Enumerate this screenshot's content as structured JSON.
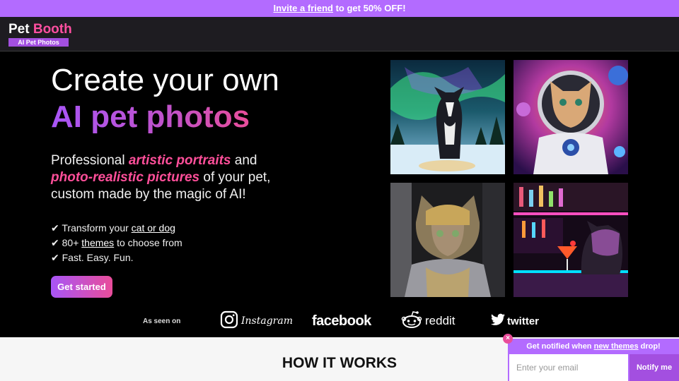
{
  "promo": {
    "link_text": "Invite a friend",
    "rest_text": " to get 50% OFF!"
  },
  "logo": {
    "word1": "Pet",
    "word2": "Booth",
    "subtitle": "AI Pet Photos"
  },
  "hero": {
    "title_line1": "Create your own",
    "title_line2": "AI pet photos",
    "desc_part1": "Professional ",
    "desc_highlight1": "artistic portraits",
    "desc_part2": " and ",
    "desc_highlight2": "photo-realistic pictures",
    "desc_part3": " of your pet, custom made by the magic of AI!",
    "features": [
      {
        "check": "✔",
        "before": " Transform your ",
        "link": "cat or dog",
        "after": ""
      },
      {
        "check": "✔",
        "before": " 80+ ",
        "link": "themes",
        "after": " to choose from"
      },
      {
        "check": "✔",
        "before": " Fast. Easy. Fun.",
        "link": "",
        "after": ""
      }
    ],
    "cta_label": "Get started"
  },
  "gallery": {
    "photos": [
      {
        "subject": "dog under northern lights",
        "icon": "dog-aurora-photo"
      },
      {
        "subject": "cat astronaut",
        "icon": "cat-astronaut-photo"
      },
      {
        "subject": "cat in knight armor",
        "icon": "cat-knight-photo"
      },
      {
        "subject": "dog at neon bar with cocktail",
        "icon": "dog-bar-photo"
      }
    ]
  },
  "press": {
    "label": "As seen on",
    "brands": [
      {
        "name": "Instagram",
        "icon": "instagram-icon"
      },
      {
        "name": "facebook",
        "icon": "facebook-wordmark"
      },
      {
        "name": "reddit",
        "icon": "reddit-icon"
      },
      {
        "name": "twitter",
        "icon": "twitter-icon"
      }
    ]
  },
  "how_it_works": {
    "title": "HOW IT WORKS"
  },
  "notify": {
    "close": "×",
    "message_before": "Get notified when ",
    "message_link": "new themes",
    "message_after": " drop!",
    "placeholder": "Enter your email",
    "button_label": "Notify me"
  },
  "colors": {
    "promo_bg": "#b36bff",
    "accent_pink": "#ff4f9a",
    "accent_purple": "#a855f7",
    "nav_bg": "#1e1c21"
  }
}
